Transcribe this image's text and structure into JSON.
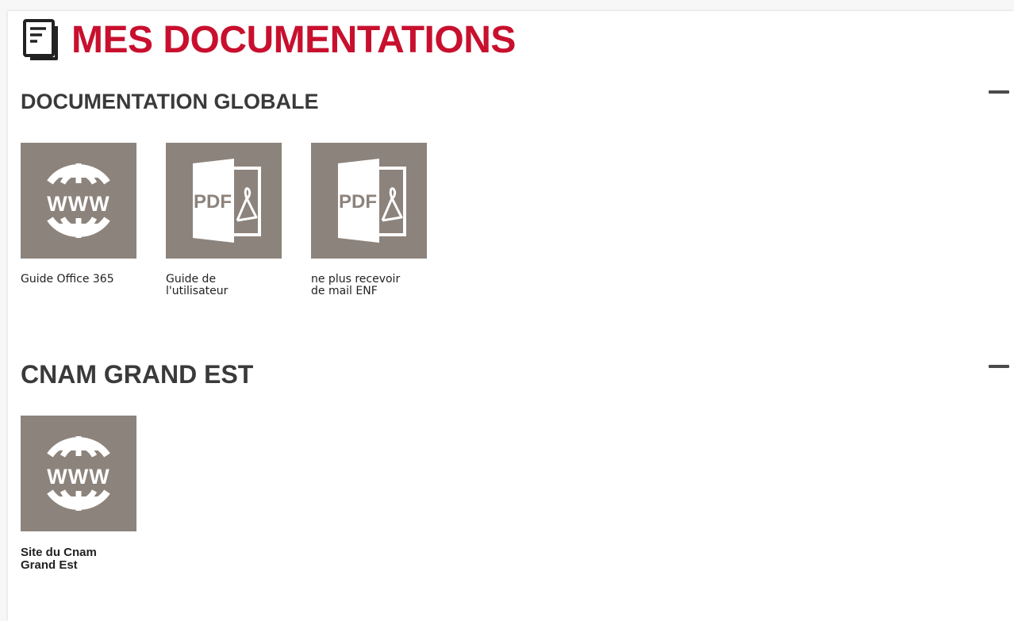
{
  "header": {
    "title": "MES DOCUMENTATIONS",
    "icon": "document-icon",
    "accent_color": "#c8102e"
  },
  "sections": [
    {
      "title": "DOCUMENTATION GLOBALE",
      "collapse_icon": "minus-icon",
      "items": [
        {
          "label": "Guide Office 365",
          "icon": "www-globe-icon"
        },
        {
          "label": "Guide de l'utilisateur",
          "icon": "pdf-file-icon"
        },
        {
          "label": "ne plus recevoir de mail ENF",
          "icon": "pdf-file-icon"
        }
      ]
    },
    {
      "title": "CNAM GRAND EST",
      "collapse_icon": "minus-icon",
      "items": [
        {
          "label": "Site du Cnam Grand Est",
          "icon": "www-globe-icon"
        }
      ]
    }
  ],
  "colors": {
    "tile_background": "#8c837c",
    "section_title": "#3a3a3a"
  }
}
